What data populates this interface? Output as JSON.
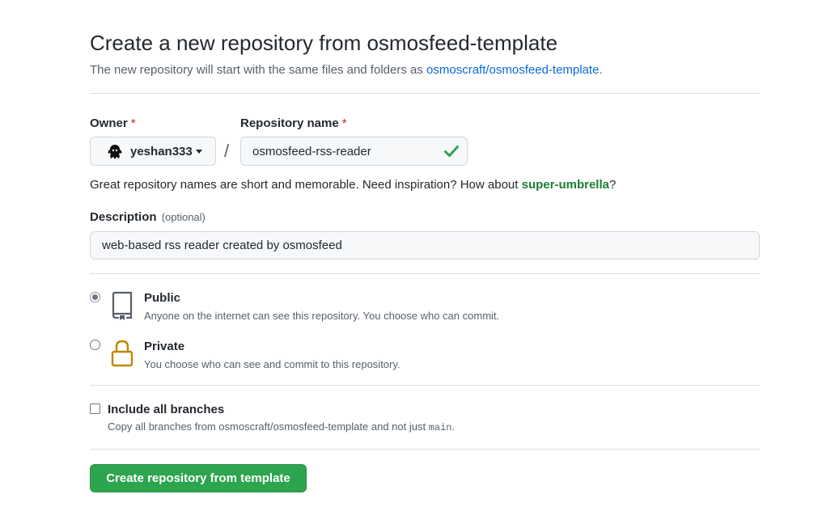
{
  "header": {
    "title": "Create a new repository from osmosfeed-template",
    "subtitle_prefix": "The new repository will start with the same files and folders as ",
    "template_link": "osmoscraft/osmosfeed-template",
    "subtitle_suffix": "."
  },
  "owner": {
    "label": "Owner",
    "required_mark": "*",
    "selected": "yeshan333"
  },
  "repo_name": {
    "label": "Repository name",
    "required_mark": "*",
    "value": "osmosfeed-rss-reader",
    "separator": "/"
  },
  "hint": {
    "prefix": "Great repository names are short and memorable. Need inspiration? How about ",
    "suggestion": "super-umbrella",
    "suffix": "?"
  },
  "description": {
    "label": "Description",
    "optional": "(optional)",
    "value": "web-based rss reader created by osmosfeed"
  },
  "visibility": {
    "public": {
      "title": "Public",
      "description": "Anyone on the internet can see this repository. You choose who can commit.",
      "checked": true
    },
    "private": {
      "title": "Private",
      "description": "You choose who can see and commit to this repository.",
      "checked": false
    }
  },
  "branches": {
    "label": "Include all branches",
    "description_prefix": "Copy all branches from osmoscraft/osmosfeed-template and not just ",
    "branch_code": "main",
    "description_suffix": ".",
    "checked": false
  },
  "submit": {
    "label": "Create repository from template"
  },
  "colors": {
    "link": "#0969da",
    "success": "#2da44e",
    "suggestion": "#1a7f37",
    "required": "#cf222e",
    "lock": "#bf8700"
  },
  "icons": {
    "public": "repo-icon",
    "private": "lock-icon",
    "valid": "check-icon",
    "owner": "avatar"
  }
}
